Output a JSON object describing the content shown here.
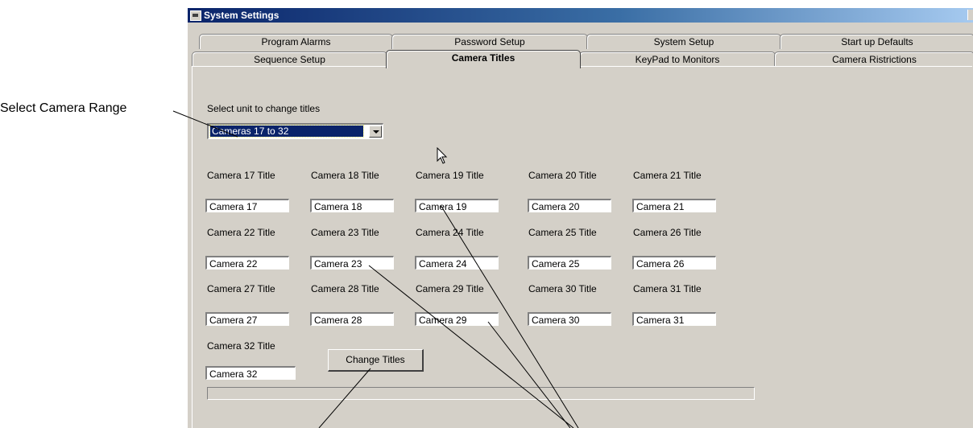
{
  "callout": {
    "label": "Select Camera Range"
  },
  "window": {
    "title": "System Settings"
  },
  "tabs_back": [
    "Program Alarms",
    "Password Setup",
    "System Setup",
    "Start up Defaults"
  ],
  "tabs_front": [
    "Sequence Setup",
    "Camera Titles",
    "KeyPad to Monitors",
    "Camera Ristrictions"
  ],
  "active_tab": "Camera Titles",
  "form": {
    "select_label": "Select unit to change titles",
    "select_value": "Cameras 17 to 32",
    "cameras": [
      {
        "label": "Camera 17 Title",
        "value": "Camera 17"
      },
      {
        "label": "Camera 18 Title",
        "value": "Camera 18"
      },
      {
        "label": "Camera 19 Title",
        "value": "Camera 19"
      },
      {
        "label": "Camera 20 Title",
        "value": "Camera 20"
      },
      {
        "label": "Camera 21 Title",
        "value": "Camera 21"
      },
      {
        "label": "Camera 22 Title",
        "value": "Camera 22"
      },
      {
        "label": "Camera 23 Title",
        "value": "Camera 23"
      },
      {
        "label": "Camera 24 Title",
        "value": "Camera 24"
      },
      {
        "label": "Camera 25 Title",
        "value": "Camera 25"
      },
      {
        "label": "Camera 26 Title",
        "value": "Camera 26"
      },
      {
        "label": "Camera 27 Title",
        "value": "Camera 27"
      },
      {
        "label": "Camera 28 Title",
        "value": "Camera 28"
      },
      {
        "label": "Camera 29 Title",
        "value": "Camera 29"
      },
      {
        "label": "Camera 30 Title",
        "value": "Camera 30"
      },
      {
        "label": "Camera 31 Title",
        "value": "Camera 31"
      },
      {
        "label": "Camera 32 Title",
        "value": "Camera 32"
      }
    ],
    "button_label": "Change Titles"
  },
  "colors": {
    "window_bg": "#d4d0c8",
    "titlebar_start": "#0a246a",
    "titlebar_end": "#a6caf0",
    "selection": "#0a246a"
  }
}
